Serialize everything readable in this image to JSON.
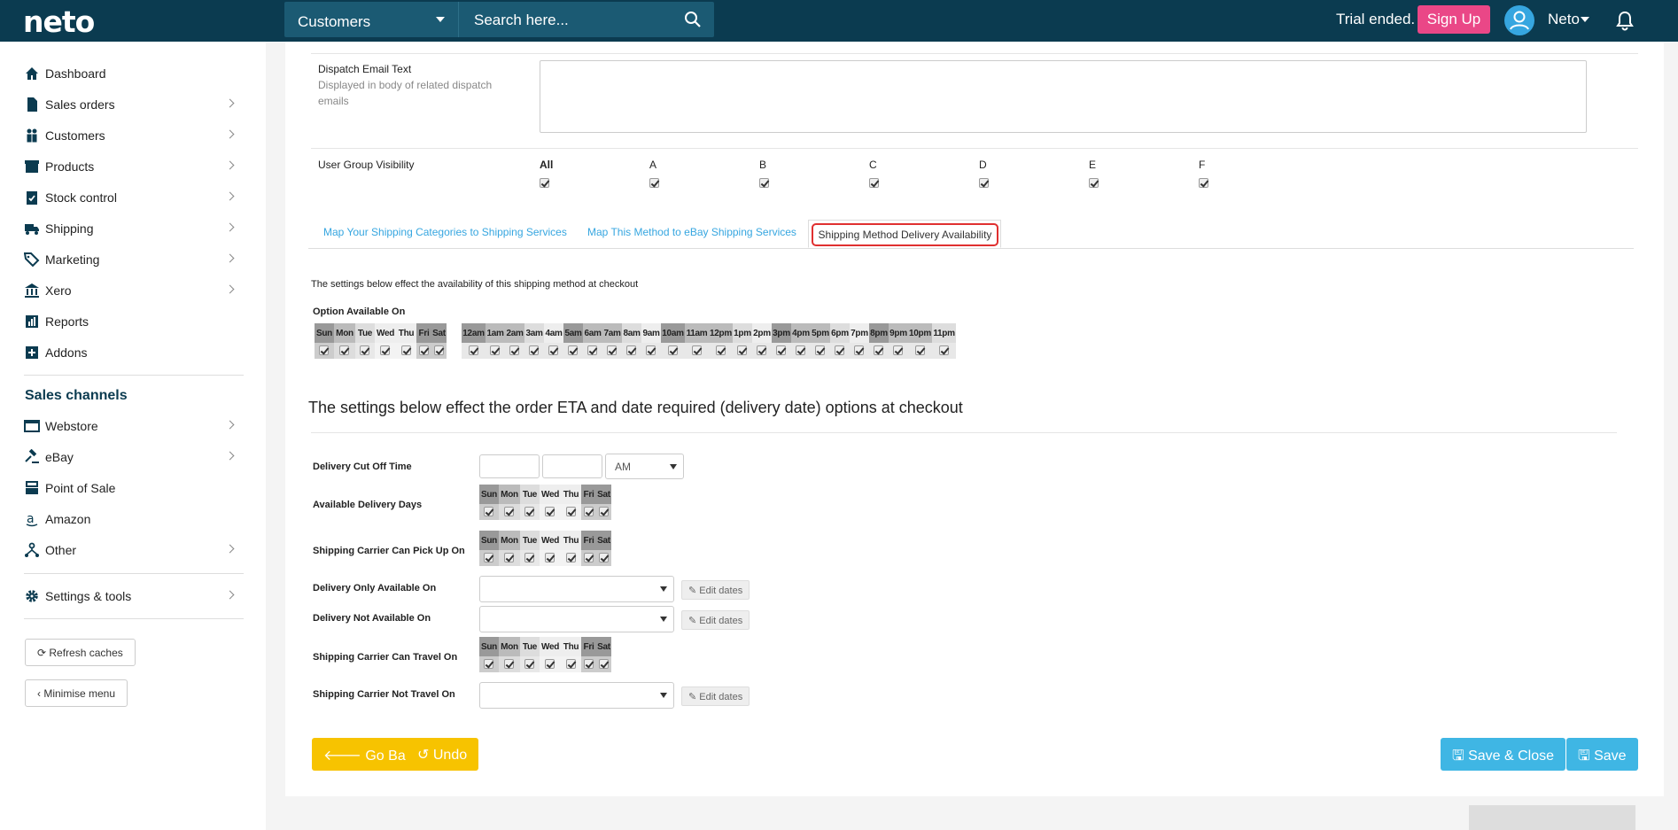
{
  "header": {
    "logo": "neto",
    "search_select": "Customers",
    "search_placeholder": "Search here...",
    "trial": "Trial ended.",
    "signup": "Sign Up",
    "user": "Neto"
  },
  "sidebar": {
    "items": [
      {
        "label": "Dashboard",
        "icon": "home-icon"
      },
      {
        "label": "Sales orders",
        "icon": "document-icon"
      },
      {
        "label": "Customers",
        "icon": "people-icon"
      },
      {
        "label": "Products",
        "icon": "box-icon"
      },
      {
        "label": "Stock control",
        "icon": "clipboard-check-icon"
      },
      {
        "label": "Shipping",
        "icon": "truck-icon"
      },
      {
        "label": "Marketing",
        "icon": "tags-icon"
      },
      {
        "label": "Xero",
        "icon": "bank-icon"
      },
      {
        "label": "Reports",
        "icon": "chart-icon"
      },
      {
        "label": "Addons",
        "icon": "plus-square-icon"
      }
    ],
    "channels_title": "Sales channels",
    "channels": [
      {
        "label": "Webstore",
        "icon": "window-icon"
      },
      {
        "label": "eBay",
        "icon": "gavel-icon"
      },
      {
        "label": "Point of Sale",
        "icon": "cash-register-icon"
      },
      {
        "label": "Amazon",
        "icon": "amazon-icon"
      },
      {
        "label": "Other",
        "icon": "network-icon"
      }
    ],
    "settings": "Settings & tools",
    "refresh": "Refresh caches",
    "minimise": "Minimise menu"
  },
  "form": {
    "dispatch_label": "Dispatch Email Text",
    "dispatch_sub1": "Displayed in body of related dispatch",
    "dispatch_sub2": "emails",
    "usergroup_label": "User Group Visibility",
    "usergroups": [
      "All",
      "A",
      "B",
      "C",
      "D",
      "E",
      "F"
    ],
    "tabs": [
      "Map Your Shipping Categories to Shipping Services",
      "Map This Method to eBay Shipping Services",
      "Shipping Method Delivery Availability"
    ],
    "avail_note": "The settings below effect the availability of this shipping method at checkout",
    "option_label": "Option Available On",
    "days": [
      "Sun",
      "Mon",
      "Tue",
      "Wed",
      "Thu",
      "Fri",
      "Sat"
    ],
    "hours": [
      "12am",
      "1am",
      "2am",
      "3am",
      "4am",
      "5am",
      "6am",
      "7am",
      "8am",
      "9am",
      "10am",
      "11am",
      "12pm",
      "1pm",
      "2pm",
      "3pm",
      "4pm",
      "5pm",
      "6pm",
      "7pm",
      "8pm",
      "9pm",
      "10pm",
      "11pm"
    ],
    "eta_heading": "The settings below effect the order ETA and date required (delivery date) options at checkout",
    "cutoff_label": "Delivery Cut Off Time",
    "ampm": "AM",
    "delivery_days_label": "Available Delivery Days",
    "pickup_label": "Shipping Carrier Can Pick Up On",
    "only_label": "Delivery Only Available On",
    "not_label": "Delivery Not Available On",
    "travel_label": "Shipping Carrier Can Travel On",
    "not_travel_label": "Shipping Carrier Not Travel On",
    "edit_dates": "Edit dates",
    "go_back": "Go Back",
    "undo": "Undo",
    "save_close": "Save & Close",
    "save": "Save"
  }
}
